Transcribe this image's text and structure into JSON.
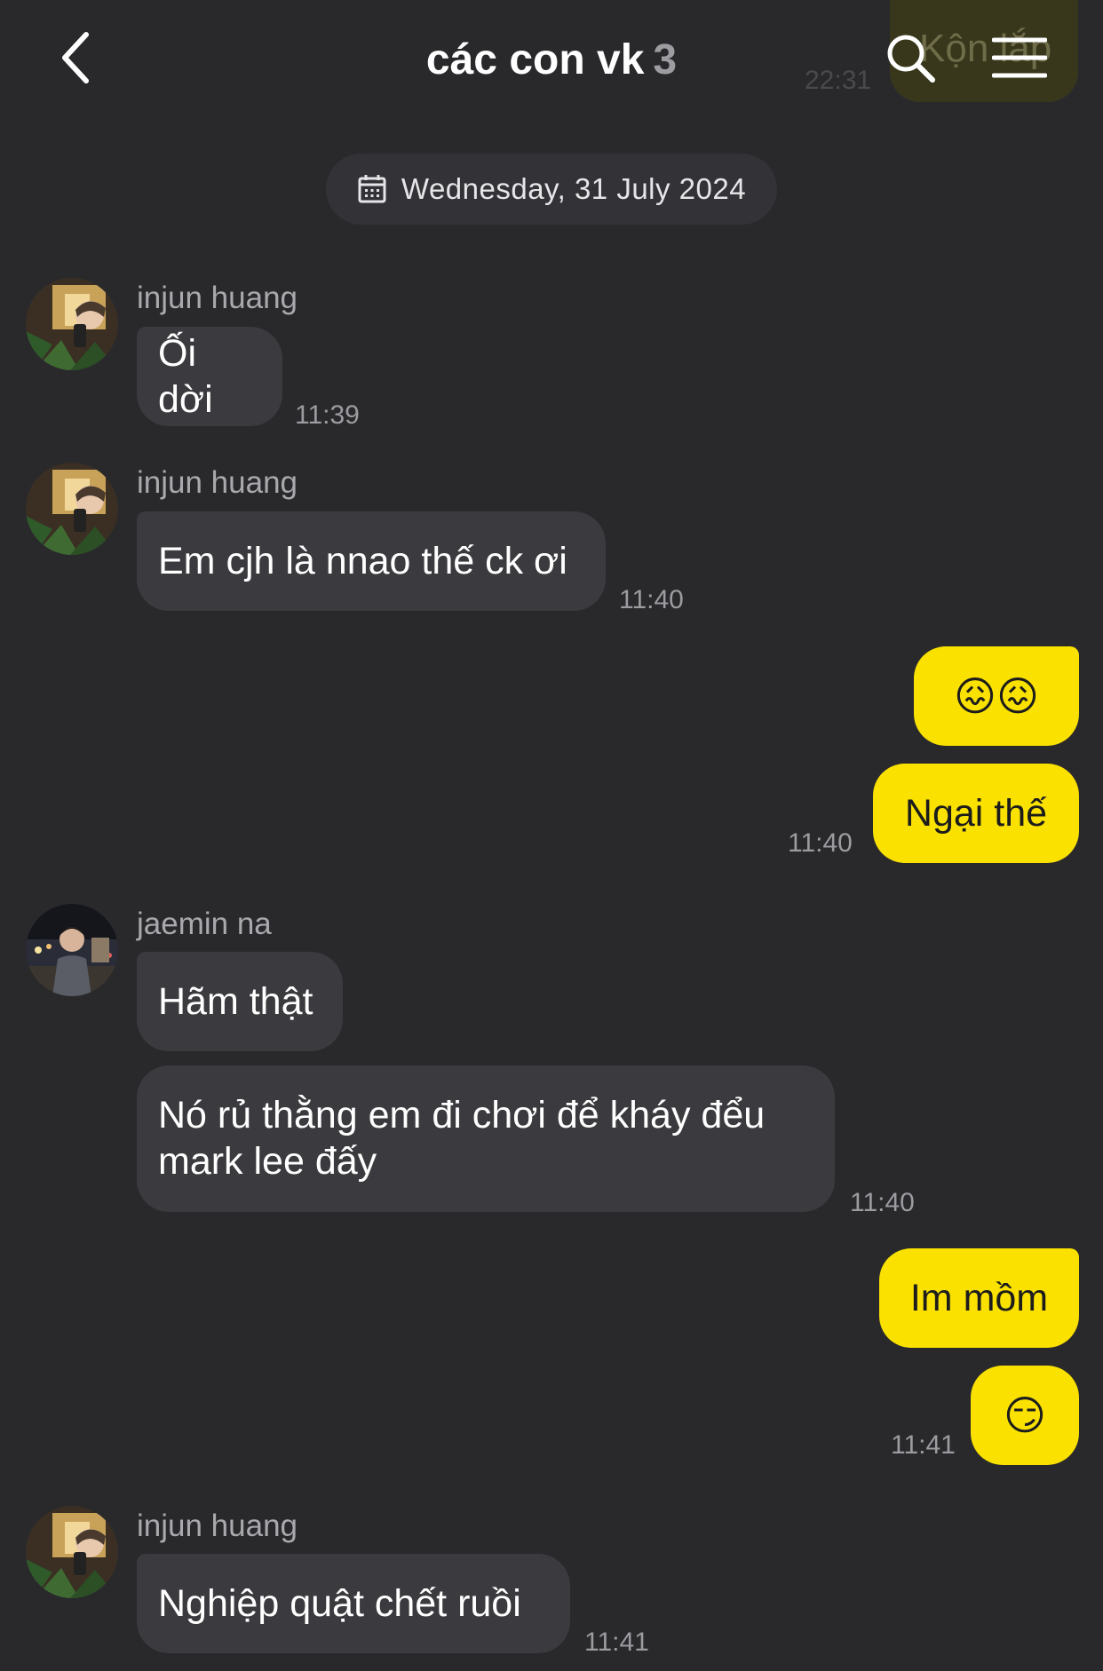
{
  "header": {
    "title": "các con vk",
    "member_count": "3",
    "behind_bubble_text": "Kộn lắp",
    "behind_bubble_time": "22:31"
  },
  "date_divider": "Wednesday, 31 July 2024",
  "messages": [
    {
      "sender": "injun huang",
      "text": "Ối dời",
      "time": "11:39"
    },
    {
      "sender": "injun huang",
      "text": "Em cjh là nnao thế ck ơi",
      "time": "11:40"
    },
    {
      "sender": "me",
      "text": "😖😖"
    },
    {
      "sender": "me",
      "text": "Ngại thế",
      "time": "11:40"
    },
    {
      "sender": "jaemin na",
      "text": "Hãm thật"
    },
    {
      "sender": "jaemin na",
      "line1": "Nó rủ thằng em đi chơi để kháy đểu",
      "line2": "mark lee đấy",
      "time": "11:40"
    },
    {
      "sender": "me",
      "text": "Im mồm"
    },
    {
      "sender": "me",
      "text": "😏",
      "time": "11:41"
    },
    {
      "sender": "injun huang",
      "text": "Nghiệp quật chết ruồi",
      "time": "11:41"
    }
  ],
  "colors": {
    "background": "#29292c",
    "incoming_bubble": "#3b3b3f",
    "outgoing_bubble": "#fae100"
  },
  "icons": {
    "back": "chevron-left-icon",
    "search": "search-icon",
    "menu": "menu-icon",
    "date": "calendar-icon"
  }
}
